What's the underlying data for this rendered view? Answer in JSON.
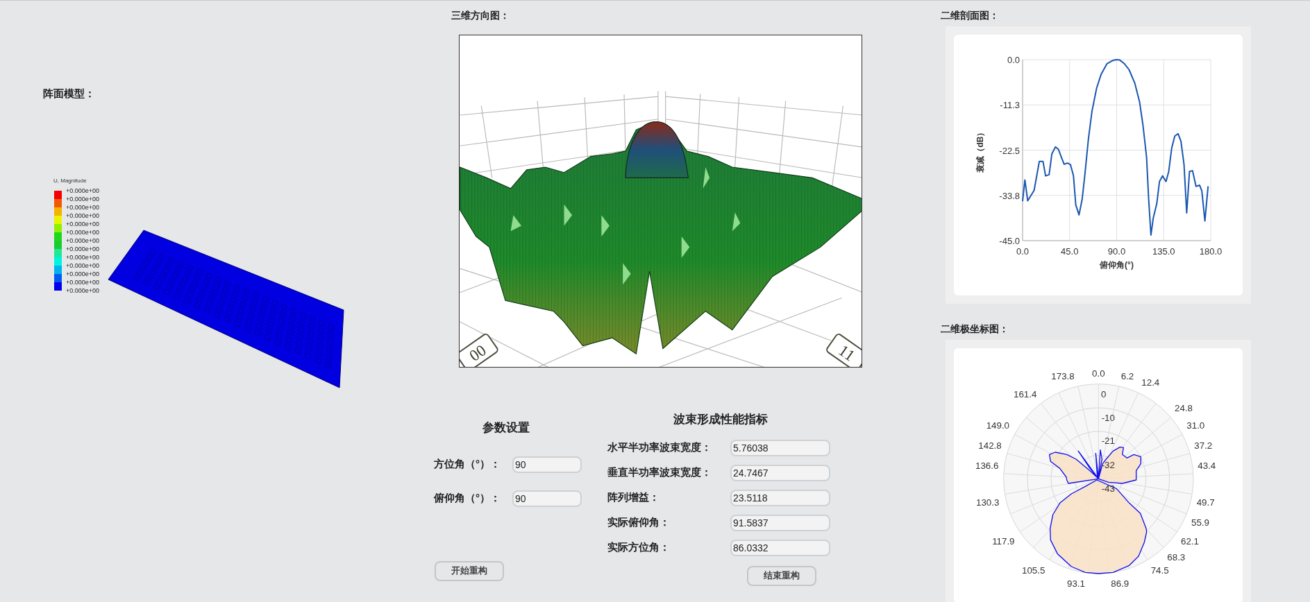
{
  "array_model": {
    "title": "阵面模型：",
    "legend": {
      "title": "U, Magnitude",
      "labels": [
        "+0.000e+00",
        "+0.000e+00",
        "+0.000e+00",
        "+0.000e+00",
        "+0.000e+00",
        "+0.000e+00",
        "+0.000e+00",
        "+0.000e+00",
        "+0.000e+00",
        "+0.000e+00",
        "+0.000e+00",
        "+0.000e+00",
        "+0.000e+00"
      ],
      "bands": [
        {
          "color": "#f40000"
        },
        {
          "color": "#f05a00"
        },
        {
          "color": "#f5b300"
        },
        {
          "color": "#e8f500"
        },
        {
          "color": "#90f000"
        },
        {
          "color": "#1ed81e"
        },
        {
          "color": "#18cc30"
        },
        {
          "color": "#20e89a"
        },
        {
          "color": "#00f5e0"
        },
        {
          "color": "#00b4f0"
        },
        {
          "color": "#005cf0"
        },
        {
          "color": "#0000ef"
        }
      ]
    }
  },
  "direction_3d": {
    "title": "三维方向图：",
    "corner_labels": [
      "00",
      "11"
    ]
  },
  "parameters": {
    "title": "参数设置",
    "fields": [
      {
        "label": "方位角（°）：",
        "value": "90"
      },
      {
        "label": "俯仰角（°）：",
        "value": "90"
      }
    ],
    "start_button": "开始重构"
  },
  "metrics": {
    "title": "波束形成性能指标",
    "fields": [
      {
        "label": "水平半功率波束宽度：",
        "value": "5.76038"
      },
      {
        "label": "垂直半功率波束宽度：",
        "value": "24.7467"
      },
      {
        "label": "阵列增益：",
        "value": "23.5118"
      },
      {
        "label": "实际俯仰角：",
        "value": "91.5837"
      },
      {
        "label": "实际方位角：",
        "value": "86.0332"
      }
    ],
    "end_button": "结束重构"
  },
  "profile": {
    "title": "二维剖面图：",
    "chart_data": {
      "type": "line",
      "xlabel": "俯仰角(°)",
      "ylabel": "衰减（dB）",
      "x": [
        0,
        2.2,
        4.9,
        11,
        16,
        19.5,
        22,
        25.4,
        28,
        31.4,
        34.3,
        37.6,
        39.8,
        43,
        45.8,
        48.7,
        50.9,
        54,
        57,
        59.7,
        63,
        66.4,
        70.8,
        75.2,
        80.8,
        86.3,
        89.6,
        93,
        97.4,
        101.9,
        107.4,
        111.9,
        115.2,
        118.6,
        120.6,
        122.8,
        125.1,
        128.4,
        131,
        133.9,
        137.2,
        139.8,
        142.7,
        145.6,
        148.7,
        151.5,
        154.4,
        157,
        159.7,
        162.6,
        165.9,
        169.3,
        171.5,
        174.4,
        177.5
      ],
      "series": [
        {
          "color": "#1a56b0",
          "values": [
            -35.2,
            -29.9,
            -35.1,
            -32.5,
            -25.3,
            -25.3,
            -28.9,
            -28.6,
            -23.4,
            -21.7,
            -22.3,
            -24.6,
            -26,
            -25.7,
            -26.1,
            -28.9,
            -36.1,
            -38.6,
            -34.7,
            -28.3,
            -19.7,
            -12.8,
            -7.1,
            -3.6,
            -1,
            -0.2,
            0,
            -0.1,
            -1,
            -2.5,
            -5.9,
            -10.5,
            -16.3,
            -24.3,
            -34.7,
            -43.6,
            -39.3,
            -35.8,
            -30.3,
            -28.9,
            -30.3,
            -27.8,
            -22,
            -19,
            -18.4,
            -20.3,
            -26,
            -38.1,
            -27.8,
            -27.6,
            -31.5,
            -31.2,
            -32.6,
            -40.1,
            -31.5
          ]
        }
      ],
      "grid": true,
      "xlim": [
        0,
        180
      ],
      "ylim": [
        -45,
        0
      ],
      "xticks": [
        {
          "value": 0,
          "label": "0.0"
        },
        {
          "value": 45,
          "label": "45.0"
        },
        {
          "value": 90,
          "label": "90.0"
        },
        {
          "value": 135,
          "label": "135.0"
        },
        {
          "value": 180,
          "label": "180.0"
        }
      ],
      "yticks": [
        {
          "value": 0,
          "label": "0.0"
        },
        {
          "value": -11.25,
          "label": "-11.3"
        },
        {
          "value": -22.5,
          "label": "-22.5"
        },
        {
          "value": -33.75,
          "label": "-33.8"
        },
        {
          "value": -45,
          "label": "-45.0"
        }
      ]
    }
  },
  "polar": {
    "title": "二维极坐标图：",
    "angle_labels": [
      "173.8",
      "0.0",
      "6.2",
      "12.4",
      "161.4",
      "24.8",
      "149.0",
      "31.0",
      "142.8",
      "37.2",
      "136.6",
      "43.4",
      "130.3",
      "49.7",
      "55.9",
      "117.9",
      "62.1",
      "68.3",
      "105.5",
      "74.5",
      "93.1",
      "86.9"
    ],
    "ring_labels": [
      "0",
      "-10",
      "-21",
      "-32",
      "-43"
    ]
  }
}
